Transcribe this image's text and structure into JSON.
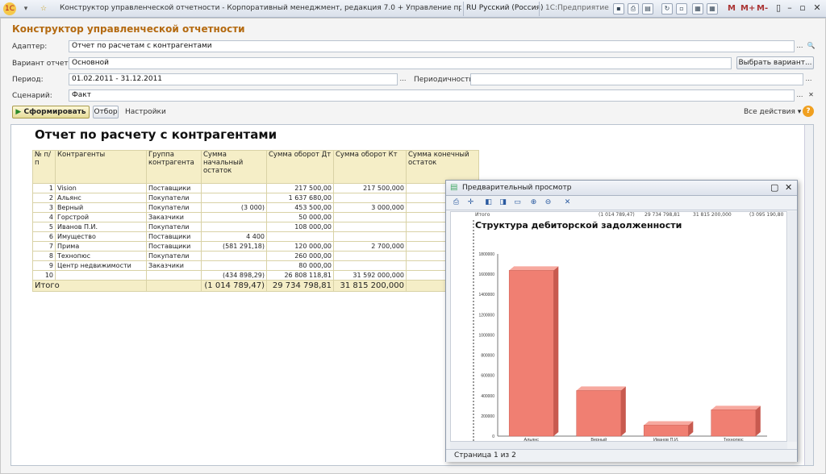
{
  "titlebar": {
    "title": "Конструктор управленческой отчетности - Корпоративный менеджмент, редакция 7.0 + Управление производственным п",
    "lang": "RU Русский (Россия)",
    "mode": "1С:Предприятие",
    "m_labels": [
      "M",
      "M+",
      "M-"
    ]
  },
  "form": {
    "title": "Конструктор управленческой отчетности",
    "adapter_label": "Адаптер:",
    "adapter_value": "Отчет по расчетам с контрагентами",
    "variant_label": "Вариант отчета:",
    "variant_value": "Основной",
    "choose_variant": "Выбрать вариант...",
    "period_label": "Период:",
    "period_value": "01.02.2011 - 31.12.2011",
    "periodicity_label": "Периодичность:",
    "periodicity_value": "",
    "scenario_label": "Сценарий:",
    "scenario_value": "Факт",
    "generate": "Сформировать",
    "filter": "Отбор",
    "settings": "Настройки",
    "all_actions": "Все действия",
    "help": "?"
  },
  "report": {
    "title": "Отчет по расчету с контрагентами",
    "headers": [
      "№ п/п",
      "Контрагенты",
      "Группа контрагента",
      "Сумма начальный остаток",
      "Сумма оборот Дт",
      "Сумма оборот Кт",
      "Сумма конечный остаток"
    ],
    "rows": [
      [
        "1",
        "Vision",
        "Поставщики",
        "",
        "217 500,00",
        "217 500,000",
        ""
      ],
      [
        "2",
        "Альянс",
        "Покупатели",
        "",
        "1 637 680,00",
        "",
        ""
      ],
      [
        "3",
        "Верный",
        "Покупатели",
        "(3 000)",
        "453 500,00",
        "3 000,000",
        ""
      ],
      [
        "4",
        "Горстрой",
        "Заказчики",
        "",
        "50 000,00",
        "",
        ""
      ],
      [
        "5",
        "Иванов П.И.",
        "Покупатели",
        "",
        "108 000,00",
        "",
        ""
      ],
      [
        "6",
        "Имущество",
        "Поставщики",
        "4 400",
        "",
        "",
        ""
      ],
      [
        "7",
        "Прима",
        "Поставщики",
        "(581 291,18)",
        "120 000,00",
        "2 700,000",
        "(46"
      ],
      [
        "8",
        "Технопюс",
        "Покупатели",
        "",
        "260 000,00",
        "",
        ""
      ],
      [
        "9",
        "Центр недвижимости",
        "Заказчики",
        "",
        "80 000,00",
        "",
        ""
      ],
      [
        "10",
        "",
        "",
        "(434 898,29)",
        "26 808 118,81",
        "31 592 000,000",
        "(5 21"
      ]
    ],
    "total": [
      "Итого",
      "",
      "(1 014 789,47)",
      "29 734 798,81",
      "31 815 200,000",
      "(3 095"
    ]
  },
  "preview": {
    "title": "Предварительный просмотр",
    "status": "Страница 1 из 2",
    "strip": [
      "Итого",
      "(1 014 789,47)",
      "29 734 798,81",
      "31 815 200,000",
      "(3 095 190,80"
    ]
  },
  "chart_data": {
    "type": "bar",
    "title": "Структура дебиторской задолженности",
    "categories": [
      "Альянс",
      "Верный",
      "Иванов П.И.",
      "Технопюс"
    ],
    "values": [
      1637680,
      450500,
      108000,
      260000
    ],
    "ylim": [
      0,
      1800000
    ],
    "yticks": [
      "0",
      "200000",
      "400000",
      "600000",
      "800000",
      "1000000",
      "1200000",
      "1400000",
      "1600000",
      "1800000"
    ],
    "bar_color": "#f07f72",
    "grid": false
  }
}
